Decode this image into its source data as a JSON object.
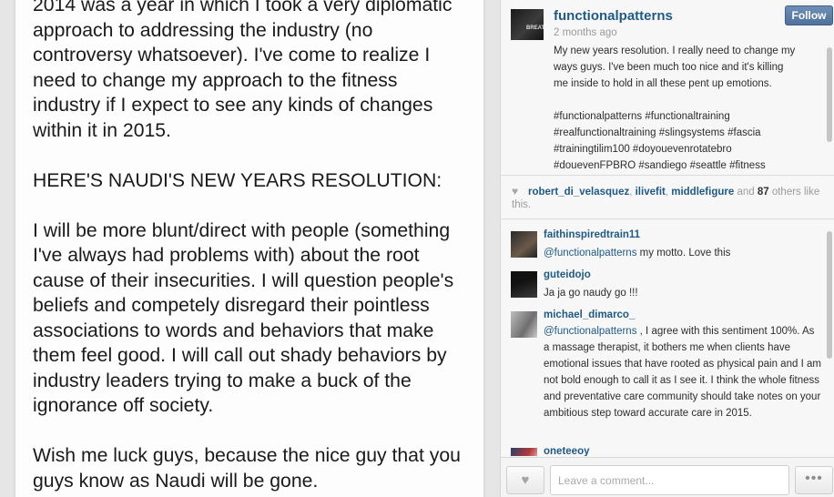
{
  "photo": {
    "paragraphs": [
      "2014 was a year in which I took a very diplomatic\napproach to addressing the industry (no\ncontroversy whatsoever). I've come to realize I\nneed to change my approach to the fitness\nindustry if I expect to see any kinds of changes\nwithin it in 2015.",
      "HERE'S NAUDI'S NEW YEARS RESOLUTION:",
      "I will be more blunt/direct with people (something\nI've always had problems with) about the root\ncause of their insecurities. I will question people's\nbeliefs and competely disregard their pointless\nassociations to words and behaviors that make\nthem feel good. I will call out shady behaviors by\nindustry leaders trying to make a buck of the\nignorance off society.",
      "Wish me luck guys, because the nice guy that you\nguys know as Naudi will be gone."
    ]
  },
  "post": {
    "username": "functionalpatterns",
    "timestamp": "2 months ago",
    "follow_label": "Follow",
    "caption_lines": [
      "My new years resolution. I really need to change my",
      "ways guys. I've been much too nice and it's killing",
      "me inside to hold in all these pent up emotions.",
      "",
      "#functionalpatterns #functionaltraining",
      "#realfunctionaltraining #slingsystems #fascia",
      "#trainingtilim100 #doyouevenrotatebro",
      "#doueven​FPBRO #sandiego #seattle #fitness"
    ]
  },
  "likes": {
    "heart_icon": "heart-icon",
    "likers": [
      "robert_di_velasquez",
      "ilivefit",
      "middlefigure"
    ],
    "sep": ", ",
    "and_text": "and",
    "count": "87",
    "others_text": "others like this."
  },
  "comments": [
    {
      "user": "faithinspiredtrain11",
      "mention": "@functionalpatterns",
      "text": " my motto. Love this"
    },
    {
      "user": "guteidojo",
      "mention": "",
      "text": "Ja ja go naudy go !!!"
    },
    {
      "user": "michael_dimarco_",
      "mention": "@functionalpatterns",
      "text": " , I agree with this sentiment 100%. As a massage therapist, it bothers me when clients have emotional issues that have rooted as physical pain and I am not bold enough to call it as I see it. I think the whole fitness and preventative care community should take notes on your ambitious step toward accurate care in 2015."
    },
    {
      "user": "oneteeoy",
      "mention": "",
      "text": ""
    }
  ],
  "footer": {
    "like_icon": "heart-icon",
    "comment_placeholder": "Leave a comment...",
    "more_label": "•••"
  }
}
